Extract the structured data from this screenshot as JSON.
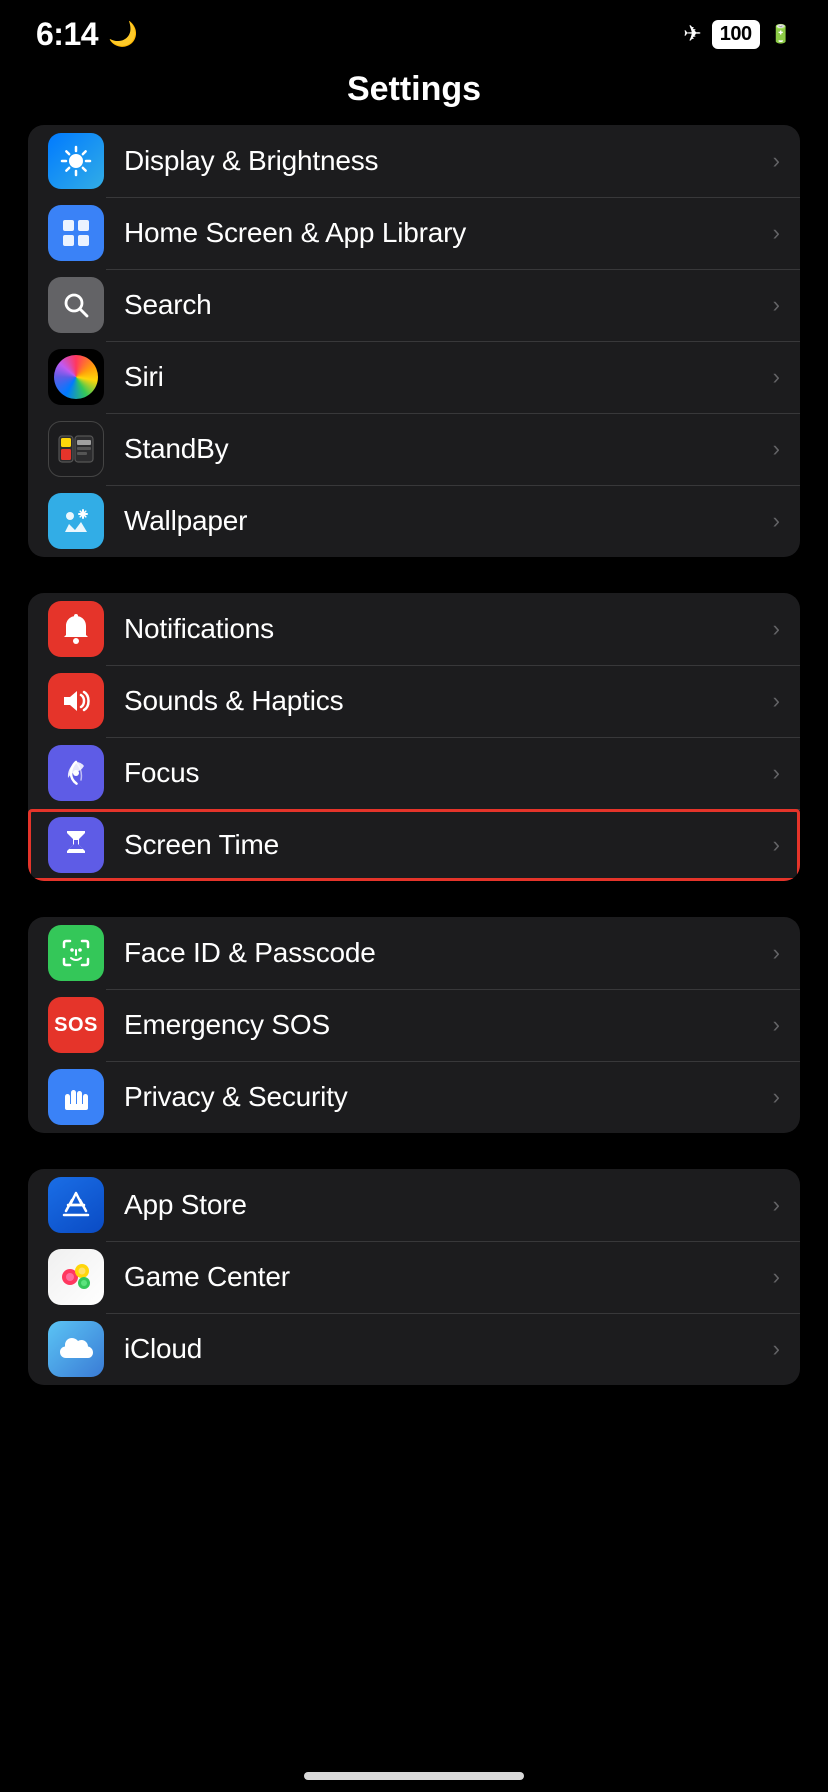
{
  "statusBar": {
    "time": "6:14",
    "moonIcon": "🌙",
    "airplaneIcon": "✈",
    "batteryLabel": "100"
  },
  "header": {
    "title": "Settings"
  },
  "groups": [
    {
      "id": "group1",
      "rows": [
        {
          "id": "display",
          "label": "Display & Brightness",
          "iconBg": "icon-display",
          "iconContent": "☀️"
        },
        {
          "id": "homescreen",
          "label": "Home Screen & App Library",
          "iconBg": "icon-homescreen",
          "iconContent": "📱"
        },
        {
          "id": "search",
          "label": "Search",
          "iconBg": "icon-search",
          "iconContent": "🔍"
        },
        {
          "id": "siri",
          "label": "Siri",
          "iconBg": "siri",
          "iconContent": ""
        },
        {
          "id": "standby",
          "label": "StandBy",
          "iconBg": "icon-standby",
          "iconContent": "⏱"
        },
        {
          "id": "wallpaper",
          "label": "Wallpaper",
          "iconBg": "icon-wallpaper",
          "iconContent": "❄️"
        }
      ]
    },
    {
      "id": "group2",
      "rows": [
        {
          "id": "notifications",
          "label": "Notifications",
          "iconBg": "icon-notifications",
          "iconContent": "🔔"
        },
        {
          "id": "sounds",
          "label": "Sounds & Haptics",
          "iconBg": "icon-sounds",
          "iconContent": "🔊"
        },
        {
          "id": "focus",
          "label": "Focus",
          "iconBg": "icon-focus",
          "iconContent": "🌙"
        },
        {
          "id": "screentime",
          "label": "Screen Time",
          "iconBg": "icon-screentime",
          "iconContent": "⏳",
          "highlighted": true
        }
      ]
    },
    {
      "id": "group3",
      "rows": [
        {
          "id": "faceid",
          "label": "Face ID & Passcode",
          "iconBg": "icon-faceid",
          "iconContent": "face"
        },
        {
          "id": "sos",
          "label": "Emergency SOS",
          "iconBg": "icon-sos",
          "iconContent": "sos"
        },
        {
          "id": "privacy",
          "label": "Privacy & Security",
          "iconBg": "icon-privacy",
          "iconContent": "hand"
        }
      ]
    },
    {
      "id": "group4",
      "rows": [
        {
          "id": "appstore",
          "label": "App Store",
          "iconBg": "icon-appstore",
          "iconContent": "appstore"
        },
        {
          "id": "gamecenter",
          "label": "Game Center",
          "iconBg": "gamecenter-icon",
          "iconContent": "gc"
        },
        {
          "id": "icloud",
          "label": "iCloud",
          "iconBg": "icon-icloud",
          "iconContent": "cloud"
        }
      ]
    }
  ],
  "chevron": "›"
}
